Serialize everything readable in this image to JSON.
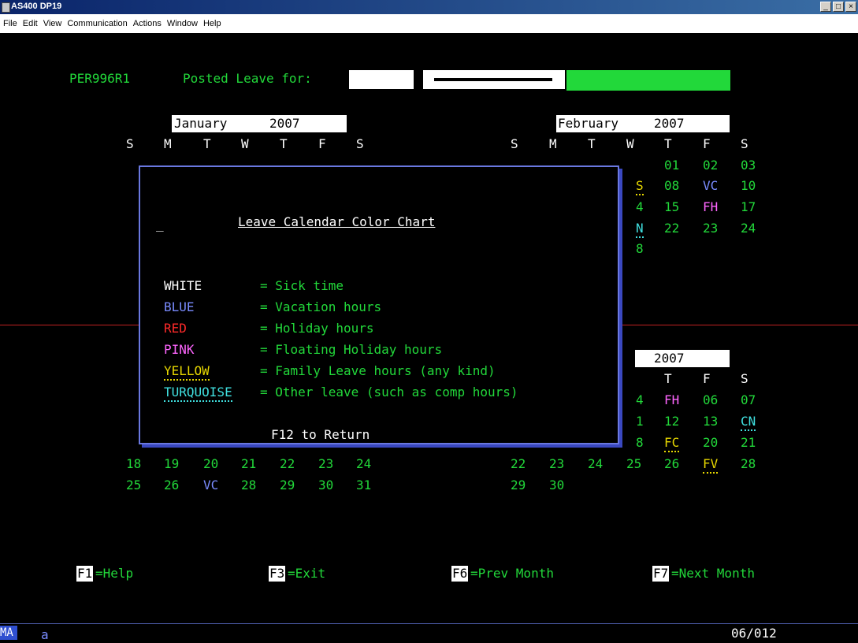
{
  "window": {
    "title": "AS400 DP19",
    "controls": [
      "_",
      "□",
      "×"
    ]
  },
  "menu": [
    "File",
    "Edit",
    "View",
    "Communication",
    "Actions",
    "Window",
    "Help"
  ],
  "header": {
    "program": "PER996R1",
    "posted_label": "Posted Leave for:"
  },
  "cal_left": {
    "month": "January",
    "year": "2007",
    "days": [
      "S",
      "M",
      "T",
      "W",
      "T",
      "F",
      "S"
    ],
    "row1": [
      "18",
      "19",
      "20",
      "21",
      "22",
      "23",
      "24"
    ],
    "row2": [
      "25",
      "26",
      "VC",
      "28",
      "29",
      "30",
      "31"
    ]
  },
  "cal_right_top": {
    "month": "February",
    "year": "2007",
    "days": [
      "S",
      "M",
      "T",
      "W",
      "T",
      "F",
      "S"
    ],
    "r1": [
      "01",
      "02",
      "03"
    ],
    "r2": [
      "S",
      "08",
      "VC",
      "10"
    ],
    "r3": [
      "4",
      "15",
      "FH",
      "17"
    ],
    "r4": [
      "N",
      "22",
      "23",
      "24"
    ],
    "r5": [
      "8"
    ]
  },
  "cal_right_bottom": {
    "year": "2007",
    "days": [
      "T",
      "F",
      "S"
    ],
    "r1": [
      "4",
      "FH",
      "06",
      "07"
    ],
    "r2": [
      "1",
      "12",
      "13",
      "CN"
    ],
    "r3": [
      "8",
      "FC",
      "20",
      "21"
    ],
    "r4": [
      "22",
      "23",
      "24",
      "25",
      "26",
      "FV",
      "28"
    ],
    "r5": [
      "29",
      "30"
    ]
  },
  "dialog": {
    "cursor": "_",
    "title": "Leave Calendar Color Chart",
    "legend": [
      {
        "color": "WHITE",
        "desc": "= Sick time"
      },
      {
        "color": "BLUE",
        "desc": "= Vacation hours"
      },
      {
        "color": "RED",
        "desc": "= Holiday hours"
      },
      {
        "color": "PINK",
        "desc": "= Floating Holiday hours"
      },
      {
        "color": "YELLOW",
        "desc": "= Family Leave hours (any kind)"
      },
      {
        "color": "TURQUOISE",
        "desc": "= Other leave (such as comp hours)"
      }
    ],
    "footer": "F12 to Return"
  },
  "fkeys": [
    {
      "key": "F1",
      "label": "=Help"
    },
    {
      "key": "F3",
      "label": "=Exit"
    },
    {
      "key": "F6",
      "label": "=Prev Month"
    },
    {
      "key": "F7",
      "label": "=Next Month"
    }
  ],
  "status": {
    "mode": "MA",
    "field": "a",
    "position": "06/012"
  },
  "colors": {
    "green": "#22d83a",
    "blue": "#7a8cff",
    "red": "#ff2a2a",
    "pink": "#ff66ff",
    "yellow": "#e8d800",
    "turquoise": "#40e0e0"
  }
}
